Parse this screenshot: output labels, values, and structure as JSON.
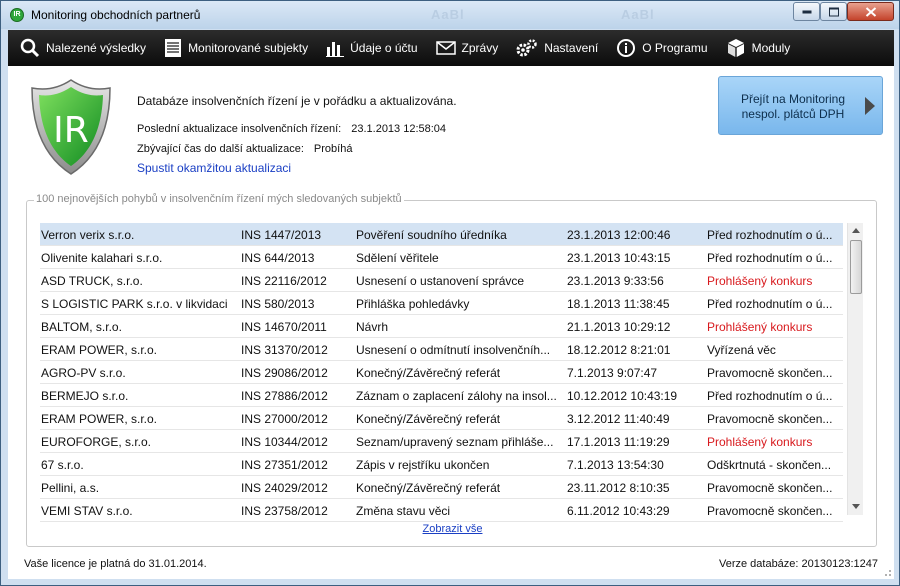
{
  "window": {
    "title": "Monitoring obchodních partnerů"
  },
  "toolbar": {
    "items": [
      {
        "label": "Nalezené výsledky",
        "icon": "search-icon"
      },
      {
        "label": "Monitorované subjekty",
        "icon": "list-icon"
      },
      {
        "label": "Údaje o účtu",
        "icon": "bar-chart-icon"
      },
      {
        "label": "Zprávy",
        "icon": "envelope-icon"
      },
      {
        "label": "Nastavení",
        "icon": "gears-icon"
      },
      {
        "label": "O Programu",
        "icon": "info-icon"
      },
      {
        "label": "Moduly",
        "icon": "box-icon"
      }
    ]
  },
  "header": {
    "logo_text": "IR",
    "status": "Databáze insolvenčních řízení je v pořádku a aktualizována.",
    "last_update_label": "Poslední aktualizace insolvenčních řízení:",
    "last_update_value": "23.1.2013 12:58:04",
    "remaining_label": "Zbývající čas do další aktualizace:",
    "remaining_value": "Probíhá",
    "run_update": "Spustit okamžitou aktualizaci",
    "dph_button": "Přejít na Monitoring nespol. plátců DPH"
  },
  "group": {
    "title": "100 nejnovějších pohybů v insolvenčním řízení mých sledovaných subjektů",
    "show_all": "Zobrazit vše"
  },
  "rows": [
    {
      "subject": "Verron verix s.r.o.",
      "ins": "INS 1447/2013",
      "event": "Pověření soudního úředníka",
      "date": "23.1.2013 12:00:46",
      "state": "Před rozhodnutím o ú...",
      "red": false,
      "selected": true
    },
    {
      "subject": "Olivenite kalahari s.r.o.",
      "ins": "INS 644/2013",
      "event": "Sdělení věřitele",
      "date": "23.1.2013 10:43:15",
      "state": "Před rozhodnutím o ú...",
      "red": false
    },
    {
      "subject": "ASD TRUCK, s.r.o.",
      "ins": "INS 22116/2012",
      "event": "Usnesení o ustanovení správce",
      "date": "23.1.2013 9:33:56",
      "state": "Prohlášený konkurs",
      "red": true
    },
    {
      "subject": "S LOGISTIC PARK s.r.o. v likvidaci",
      "ins": "INS 580/2013",
      "event": "Přihláška pohledávky",
      "date": "18.1.2013 11:38:45",
      "state": "Před rozhodnutím o ú...",
      "red": false
    },
    {
      "subject": "BALTOM, s.r.o.",
      "ins": "INS 14670/2011",
      "event": "Návrh",
      "date": "21.1.2013 10:29:12",
      "state": "Prohlášený konkurs",
      "red": true
    },
    {
      "subject": "ERAM POWER, s.r.o.",
      "ins": "INS 31370/2012",
      "event": "Usnesení o odmítnutí insolvenčníh...",
      "date": "18.12.2012 8:21:01",
      "state": "Vyřízená věc",
      "red": false
    },
    {
      "subject": "AGRO-PV s.r.o.",
      "ins": "INS 29086/2012",
      "event": "Konečný/Závěrečný referát",
      "date": "7.1.2013 9:07:47",
      "state": "Pravomocně skončen...",
      "red": false
    },
    {
      "subject": "BERMEJO s.r.o.",
      "ins": "INS 27886/2012",
      "event": "Záznam o zaplacení zálohy na insol...",
      "date": "10.12.2012 10:43:19",
      "state": "Před rozhodnutím o ú...",
      "red": false
    },
    {
      "subject": "ERAM POWER, s.r.o.",
      "ins": "INS 27000/2012",
      "event": "Konečný/Závěrečný referát",
      "date": "3.12.2012 11:40:49",
      "state": "Pravomocně skončen...",
      "red": false
    },
    {
      "subject": "EUROFORGE, s.r.o.",
      "ins": "INS 10344/2012",
      "event": "Seznam/upravený seznam přihláše...",
      "date": "17.1.2013 11:19:29",
      "state": "Prohlášený konkurs",
      "red": true
    },
    {
      "subject": "67 s.r.o.",
      "ins": "INS 27351/2012",
      "event": "Zápis v rejstříku ukončen",
      "date": "7.1.2013 13:54:30",
      "state": "Odškrtnutá - skončen...",
      "red": false
    },
    {
      "subject": "Pellini, a.s.",
      "ins": "INS 24029/2012",
      "event": "Konečný/Závěrečný referát",
      "date": "23.11.2012 8:10:35",
      "state": "Pravomocně skončen...",
      "red": false
    },
    {
      "subject": "VEMI STAV s.r.o.",
      "ins": "INS 23758/2012",
      "event": "Změna stavu věci",
      "date": "6.11.2012 10:43:29",
      "state": "Pravomocně skončen...",
      "red": false
    }
  ],
  "footer": {
    "license": "Vaše licence je platná do 31.01.2014.",
    "db_version": "Verze databáze: 20130123:1247"
  },
  "colors": {
    "accent_red": "#d8191d",
    "link_blue": "#1a3fc4",
    "selection": "#d4e3f3",
    "shield_green": "#2fa63a"
  }
}
